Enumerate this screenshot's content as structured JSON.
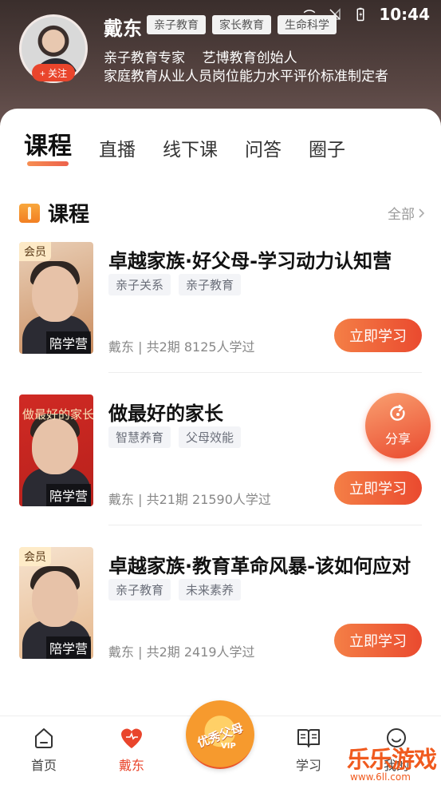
{
  "status_bar": {
    "time": "10:44"
  },
  "profile": {
    "name": "戴东",
    "tags": [
      "亲子教育",
      "家长教育",
      "生命科学"
    ],
    "follow_label": "+ 关注",
    "desc_line1": "亲子教育专家    艺博教育创始人",
    "desc_line2": "家庭教育从业人员岗位能力水平评价标准制定者"
  },
  "tabs": [
    "课程",
    "直播",
    "线下课",
    "问答",
    "圈子"
  ],
  "section": {
    "title": "课程",
    "all_label": "全部"
  },
  "courses": [
    {
      "title": "卓越家族·好父母-学习动力认知营",
      "tags": [
        "亲子关系",
        "亲子教育"
      ],
      "meta": "戴东 | 共2期   8125人学过",
      "badge": "会员",
      "ribbon": "陪学营",
      "cover_title": "",
      "button": "立即学习"
    },
    {
      "title": "做最好的家长",
      "tags": [
        "智慧养育",
        "父母效能"
      ],
      "meta": "戴东 | 共21期   21590人学过",
      "badge": "",
      "ribbon": "陪学营",
      "cover_title": "做最好的家长",
      "button": "立即学习"
    },
    {
      "title": "卓越家族·教育革命风暴-该如何应对",
      "tags": [
        "亲子教育",
        "未来素养"
      ],
      "meta": "戴东 | 共2期   2419人学过",
      "badge": "会员",
      "ribbon": "陪学营",
      "cover_title": "",
      "button": "立即学习"
    }
  ],
  "share_label": "分享",
  "bottom_nav": {
    "home": "首页",
    "teacher": "戴东",
    "promo": "优秀父母",
    "promo_sub": "VIP",
    "study": "学习",
    "mine": "我的"
  },
  "watermark": {
    "line1": "乐乐游戏",
    "line2": "www.6ll.com"
  },
  "colors": {
    "accent": "#ea4a2f",
    "header_bg": "#3a2e2c"
  }
}
